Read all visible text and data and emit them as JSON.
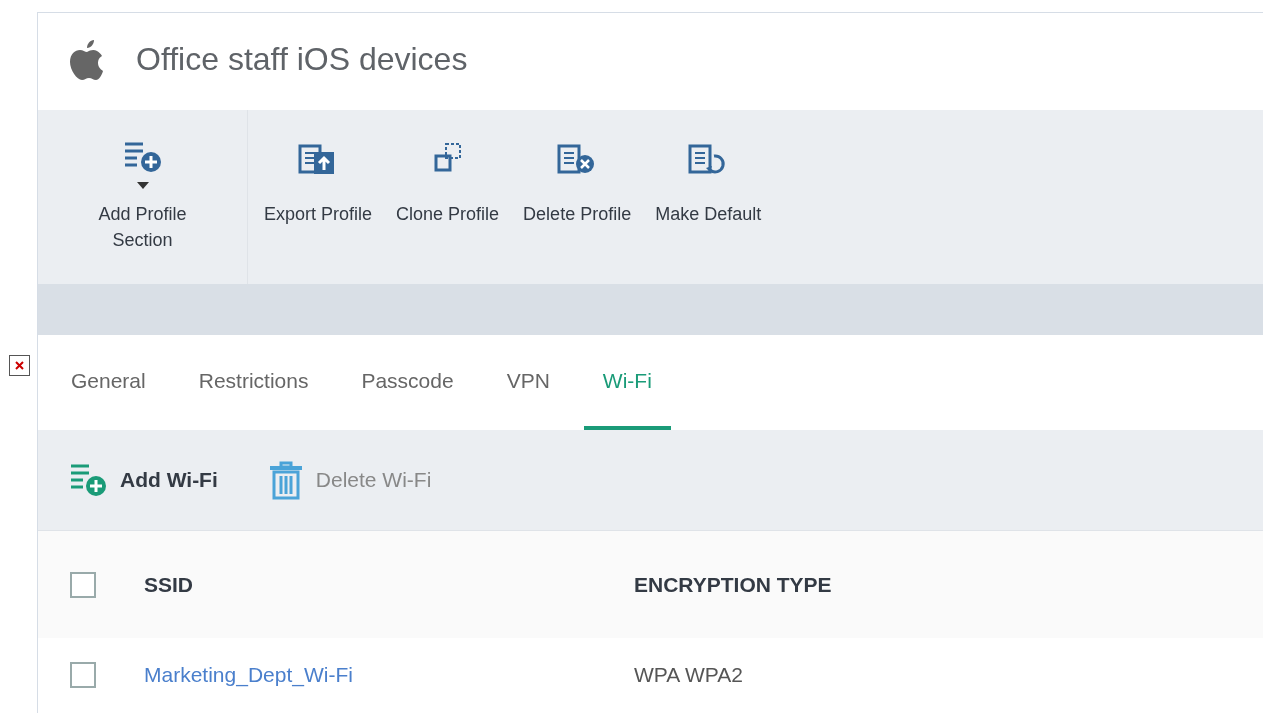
{
  "header": {
    "title": "Office staff iOS devices"
  },
  "toolbar": [
    {
      "kind": "add",
      "label": "Add Profile Section",
      "dropdown": true
    },
    {
      "kind": "export",
      "label": "Export Profile",
      "dropdown": false
    },
    {
      "kind": "clone",
      "label": "Clone Profile",
      "dropdown": false
    },
    {
      "kind": "delete",
      "label": "Delete Profile",
      "dropdown": false
    },
    {
      "kind": "default",
      "label": "Make Default",
      "dropdown": false
    }
  ],
  "tabs": [
    {
      "label": "General",
      "selected": false
    },
    {
      "label": "Restrictions",
      "selected": false
    },
    {
      "label": "Passcode",
      "selected": false
    },
    {
      "label": "VPN",
      "selected": false
    },
    {
      "label": "Wi-Fi",
      "selected": true
    }
  ],
  "actions": [
    {
      "kind": "add",
      "label": "Add Wi-Fi",
      "disabled": false
    },
    {
      "kind": "delete",
      "label": "Delete Wi-Fi",
      "disabled": true
    }
  ],
  "table": {
    "header_checked": false,
    "columns": [
      "SSID",
      "ENCRYPTION TYPE"
    ],
    "rows": [
      {
        "checked": false,
        "ssid": "Marketing_Dept_Wi-Fi",
        "encryption": "WPA WPA2"
      }
    ]
  }
}
